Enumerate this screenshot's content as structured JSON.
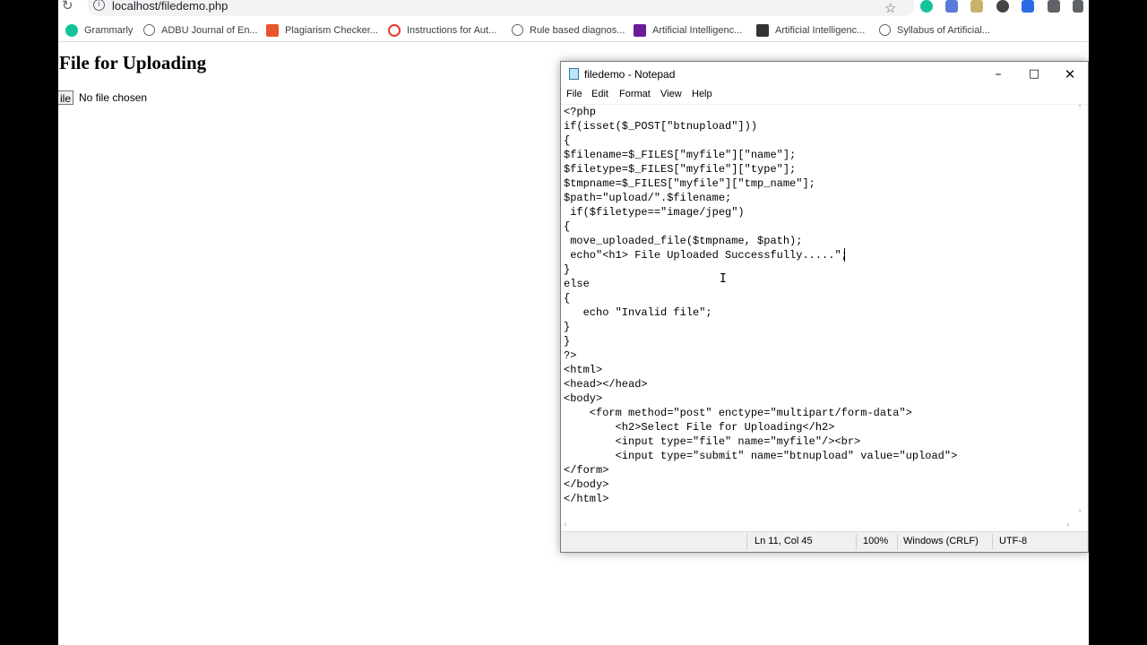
{
  "browser": {
    "url": "localhost/filedemo.php",
    "bookmarks": [
      {
        "label": "Grammarly",
        "color": "#15c39a"
      },
      {
        "label": "ADBU Journal of En...",
        "color": "#5f6368"
      },
      {
        "label": "Plagiarism Checker...",
        "color": "#e8552b"
      },
      {
        "label": "Instructions for Aut...",
        "color": "#e53935"
      },
      {
        "label": "Rule based diagnos...",
        "color": "#5f6368"
      },
      {
        "label": "Artificial Intelligenc...",
        "color": "#6a1b9a"
      },
      {
        "label": "Artificial Intelligenc...",
        "color": "#333333"
      },
      {
        "label": "Syllabus of Artificial...",
        "color": "#5f6368"
      }
    ]
  },
  "page": {
    "heading": "File for Uploading",
    "file_button": "ile",
    "file_status": "No file chosen"
  },
  "notepad": {
    "title": "filedemo - Notepad",
    "menu": [
      "File",
      "Edit",
      "Format",
      "View",
      "Help"
    ],
    "code": "<?php\nif(isset($_POST[\"btnupload\"]))\n{\n$filename=$_FILES[\"myfile\"][\"name\"];\n$filetype=$_FILES[\"myfile\"][\"type\"];\n$tmpname=$_FILES[\"myfile\"][\"tmp_name\"];\n$path=\"upload/\".$filename;\n if($filetype==\"image/jpeg\")\n{\n move_uploaded_file($tmpname, $path);\n echo\"<h1> File Uploaded Successfully.....\";\n}\nelse\n{\n   echo \"Invalid file\";\n}\n}\n?>\n<html>\n<head></head>\n<body>\n    <form method=\"post\" enctype=\"multipart/form-data\">\n        <h2>Select File for Uploading</h2>\n        <input type=\"file\" name=\"myfile\"/><br>\n        <input type=\"submit\" name=\"btnupload\" value=\"upload\">\n</form>\n</body>\n</html>",
    "status": {
      "position": "Ln 11, Col 45",
      "zoom": "100%",
      "line_endings": "Windows (CRLF)",
      "encoding": "UTF-8"
    }
  }
}
